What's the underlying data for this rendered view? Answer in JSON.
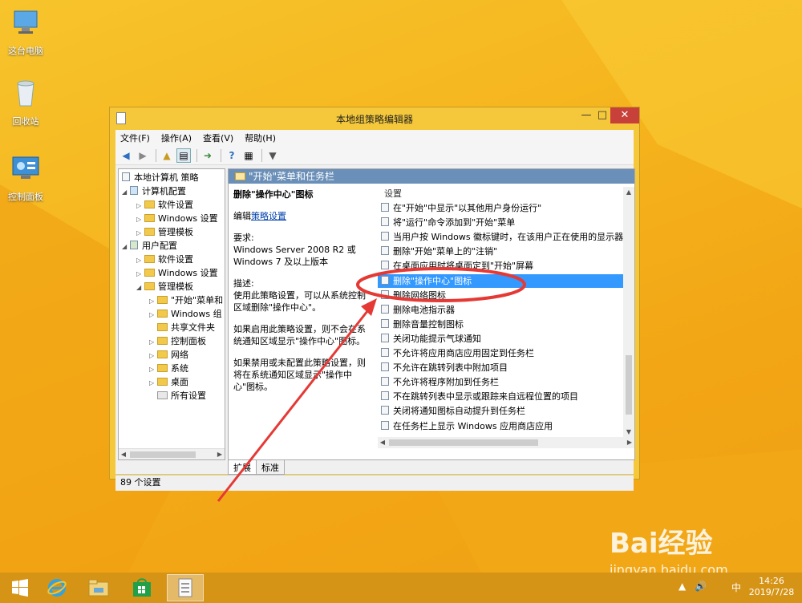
{
  "desktop": {
    "icons": [
      {
        "label": "这台电脑",
        "icon": "computer-icon"
      },
      {
        "label": "回收站",
        "icon": "recycle-bin-icon"
      },
      {
        "label": "控制面板",
        "icon": "control-panel-icon"
      }
    ]
  },
  "window": {
    "title": "本地组策略编辑器",
    "minimize": "—",
    "maximize": "□",
    "close": "✕",
    "menu": [
      "文件(F)",
      "操作(A)",
      "查看(V)",
      "帮助(H)"
    ],
    "toolbar_icons": [
      "back-icon",
      "forward-icon",
      "up-folder-icon",
      "show-tree-icon",
      "export-icon",
      "help-icon",
      "properties-icon",
      "filter-icon"
    ]
  },
  "tree": {
    "items": [
      {
        "label": "本地计算机 策略",
        "arrow": "",
        "icon": "policy-icon"
      },
      {
        "label": "计算机配置",
        "arrow": "◢",
        "icon": "computer-config-icon"
      },
      {
        "label": "软件设置",
        "arrow": "▷",
        "icon": "folder-icon"
      },
      {
        "label": "Windows 设置",
        "arrow": "▷",
        "icon": "folder-icon"
      },
      {
        "label": "管理模板",
        "arrow": "▷",
        "icon": "folder-icon"
      },
      {
        "label": "用户配置",
        "arrow": "◢",
        "icon": "user-config-icon"
      },
      {
        "label": "软件设置",
        "arrow": "▷",
        "icon": "folder-icon"
      },
      {
        "label": "Windows 设置",
        "arrow": "▷",
        "icon": "folder-icon"
      },
      {
        "label": "管理模板",
        "arrow": "◢",
        "icon": "folder-icon"
      },
      {
        "label": "\"开始\"菜单和",
        "arrow": "▷",
        "icon": "folder-icon"
      },
      {
        "label": "Windows 组",
        "arrow": "▷",
        "icon": "folder-icon"
      },
      {
        "label": "共享文件夹",
        "arrow": "",
        "icon": "folder-icon"
      },
      {
        "label": "控制面板",
        "arrow": "▷",
        "icon": "folder-icon"
      },
      {
        "label": "网络",
        "arrow": "▷",
        "icon": "folder-icon"
      },
      {
        "label": "系统",
        "arrow": "▷",
        "icon": "folder-icon"
      },
      {
        "label": "桌面",
        "arrow": "▷",
        "icon": "folder-icon"
      },
      {
        "label": "所有设置",
        "arrow": "",
        "icon": "settings-icon"
      }
    ]
  },
  "right": {
    "header": "\"开始\"菜单和任务栏",
    "policy_title": "删除\"操作中心\"图标",
    "edit_prefix": "编辑",
    "edit_link": "策略设置",
    "requirements_label": "要求:",
    "requirements_text": "Windows Server 2008 R2 或 Windows 7 及以上版本",
    "description_label": "描述:",
    "description_text": "使用此策略设置，可以从系统控制区域删除\"操作中心\"。",
    "enabled_text": "如果启用此策略设置，则不会在系统通知区域显示\"操作中心\"图标。",
    "disabled_text": "如果禁用或未配置此策略设置，则将在系统通知区域显示\"操作中心\"图标。",
    "list_header": "设置",
    "list": [
      "在\"开始\"中显示\"以其他用户身份运行\"",
      "将\"运行\"命令添加到\"开始\"菜单",
      "当用户按 Windows 徽标键时，在该用户正在使用的显示器...",
      "删除\"开始\"菜单上的\"注销\"",
      "在桌面应用时将桌面定到\"开始\"屏幕",
      "删除\"操作中心\"图标",
      "删除网络图标",
      "删除电池指示器",
      "删除音量控制图标",
      "关闭功能提示气球通知",
      "不允许将应用商店应用固定到任务栏",
      "不允许在跳转列表中附加项目",
      "不允许将程序附加到任务栏",
      "不在跳转列表中显示或跟踪来自远程位置的项目",
      "关闭将通知图标自动提升到任务栏",
      "在任务栏上显示 Windows 应用商店应用"
    ],
    "selected_index": 5,
    "tabs": [
      "扩展",
      "标准"
    ]
  },
  "status": "89 个设置",
  "taskbar": {
    "items": [
      "start-icon",
      "ie-icon",
      "explorer-icon",
      "store-icon",
      "gpedit-icon"
    ],
    "tray": [
      "▲",
      "🔊",
      "中"
    ],
    "time": "14:26",
    "date": "2019/7/28"
  },
  "watermark": {
    "brand": "Bai经验",
    "url": "jingyan.baidu.com"
  },
  "colors": {
    "selection": "#3399ff",
    "annotation": "#e53935",
    "window_frame": "#f4c83a"
  }
}
